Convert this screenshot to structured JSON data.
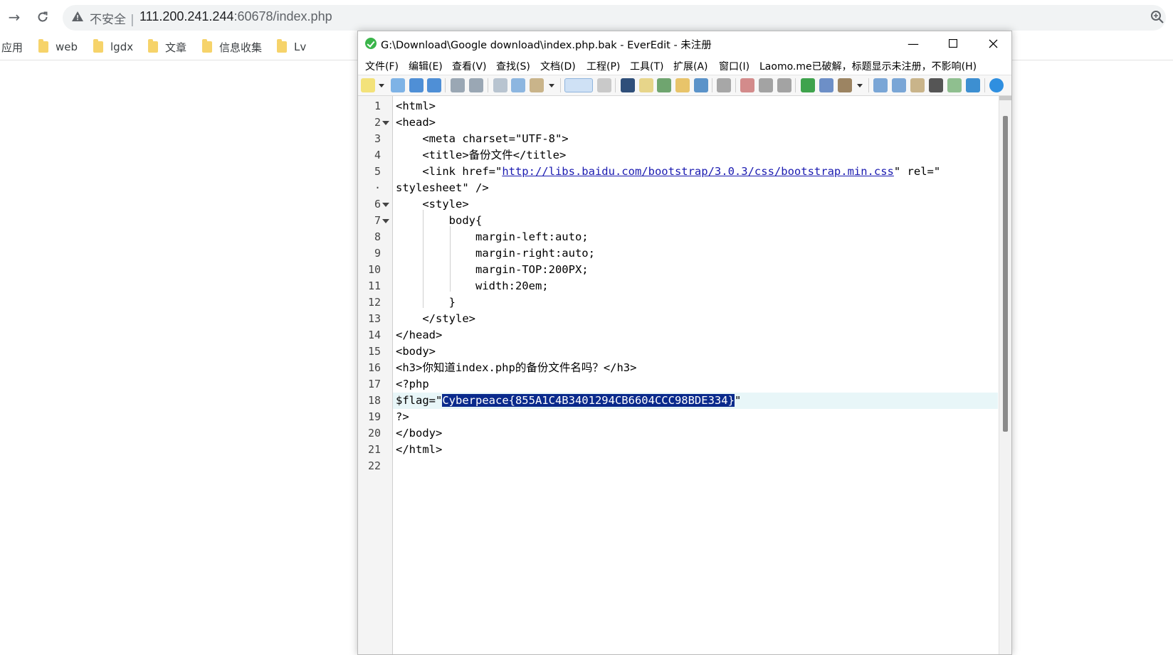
{
  "browser": {
    "insecure_label": "不安全",
    "url_host": "111.200.241.244",
    "url_rest": ":60678/index.php",
    "bookmarks": [
      {
        "label": "应用",
        "folder": false
      },
      {
        "label": "web",
        "folder": true
      },
      {
        "label": "lgdx",
        "folder": true
      },
      {
        "label": "文章",
        "folder": true
      },
      {
        "label": "信息收集",
        "folder": true
      },
      {
        "label": "Lv",
        "folder": true
      }
    ]
  },
  "editor": {
    "title": "G:\\Download\\Google download\\index.php.bak - EverEdit - 未注册",
    "menu": [
      "文件(F)",
      "编辑(E)",
      "查看(V)",
      "查找(S)",
      "文档(D)",
      "工程(P)",
      "工具(T)",
      "扩展(A)",
      "窗口(I)",
      "Laomo.me已破解，标题显示未注册，不影响(H)"
    ],
    "lines": [
      {
        "num": "1",
        "text": "<html>"
      },
      {
        "num": "2",
        "text": "<head>",
        "fold": true
      },
      {
        "num": "3",
        "text": "    <meta charset=\"UTF-8\">"
      },
      {
        "num": "4",
        "text": "    <title>备份文件</title>"
      },
      {
        "num": "5",
        "pre": "    <link href=\"",
        "link": "http://libs.baidu.com/bootstrap/3.0.3/css/bootstrap.min.css",
        "post": "\" rel=\""
      },
      {
        "num": "·",
        "text": "stylesheet\" />"
      },
      {
        "num": "6",
        "text": "    <style>",
        "fold": true
      },
      {
        "num": "7",
        "text": "        body{",
        "fold": true
      },
      {
        "num": "8",
        "text": "            margin-left:auto;"
      },
      {
        "num": "9",
        "text": "            margin-right:auto;"
      },
      {
        "num": "10",
        "text": "            margin-TOP:200PX;"
      },
      {
        "num": "11",
        "text": "            width:20em;"
      },
      {
        "num": "12",
        "text": "        }"
      },
      {
        "num": "13",
        "text": "    </style>"
      },
      {
        "num": "14",
        "text": "</head>"
      },
      {
        "num": "15",
        "text": "<body>"
      },
      {
        "num": "16",
        "text": "<h3>你知道index.php的备份文件名吗？</h3>"
      },
      {
        "num": "17",
        "text": "<?php"
      },
      {
        "num": "18",
        "pre": "$flag=\"",
        "sel": "Cyberpeace{855A1C4B3401294CB6604CCC98BDE334}",
        "post": "\"",
        "current": true
      },
      {
        "num": "19",
        "text": "?>"
      },
      {
        "num": "20",
        "text": "</body>"
      },
      {
        "num": "21",
        "text": "</html>"
      },
      {
        "num": "22",
        "text": ""
      }
    ]
  },
  "icons": [
    "arrow-forward-icon",
    "reload-icon",
    "warning-icon",
    "zoom-icon",
    "folder-icon",
    "app-check-icon",
    "minimize-icon",
    "maximize-icon",
    "close-icon"
  ]
}
